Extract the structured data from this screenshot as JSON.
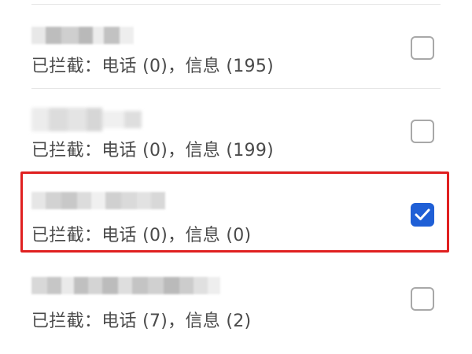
{
  "blocked_list": [
    {
      "blocked_summary": "已拦截：电话 (0)，信息 (195)",
      "checked": false
    },
    {
      "blocked_summary": "已拦截：电话 (0)，信息 (199)",
      "checked": false
    },
    {
      "blocked_summary": "已拦截：电话 (0)，信息 (0)",
      "checked": true
    },
    {
      "blocked_summary": "已拦截：电话 (7)，信息 (2)",
      "checked": false
    }
  ],
  "colors": {
    "checkbox_checked": "#1f5fd6",
    "highlight_border": "#e02020",
    "text": "#4a4a4a"
  }
}
